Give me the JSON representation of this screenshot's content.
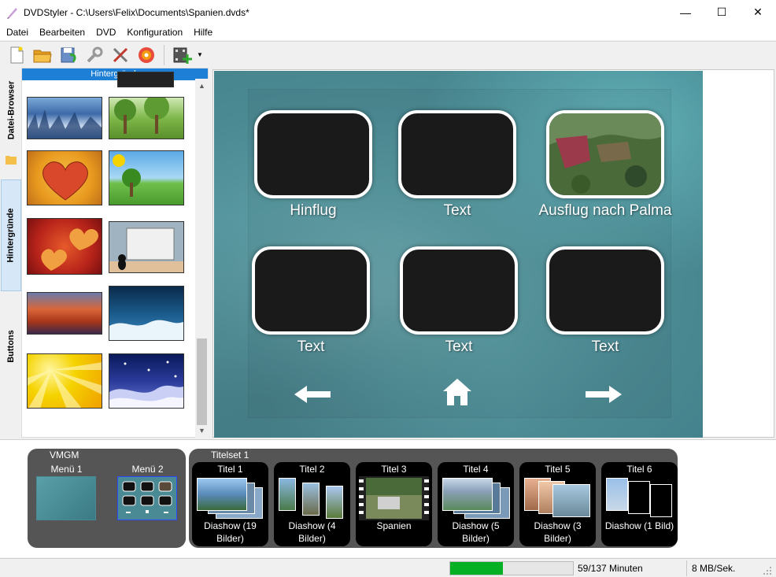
{
  "window": {
    "title": "DVDStyler - C:\\Users\\Felix\\Documents\\Spanien.dvds*",
    "minimize": "—",
    "maximize": "☐",
    "close": "✕"
  },
  "menubar": [
    "Datei",
    "Bearbeiten",
    "DVD",
    "Konfiguration",
    "Hilfe"
  ],
  "toolbar": {
    "icons": [
      "new-icon",
      "open-icon",
      "save-icon",
      "settings-icon",
      "tools-icon",
      "burn-icon",
      "add-file-icon"
    ]
  },
  "sidebar": {
    "tabs": [
      "Datei-Browser",
      "Hintergründe",
      "Buttons"
    ],
    "active_tab": "Hintergründe",
    "gallery_header": "Hintergründe"
  },
  "menu": {
    "buttons": [
      {
        "label": "Hinflug",
        "has_image": false
      },
      {
        "label": "Text",
        "has_image": false
      },
      {
        "label": "Ausflug nach Palma",
        "has_image": true
      },
      {
        "label": "Text",
        "has_image": false
      },
      {
        "label": "Text",
        "has_image": false
      },
      {
        "label": "Text",
        "has_image": false
      }
    ],
    "nav": [
      "arrow-left-icon",
      "home-icon",
      "arrow-right-icon"
    ]
  },
  "titleset": {
    "vmgm_label": "VMGM",
    "titleset_label": "Titelset 1",
    "menus": [
      {
        "title": "Menü 1"
      },
      {
        "title": "Menü 2"
      }
    ],
    "titles": [
      {
        "title": "Titel 1",
        "caption": "Diashow (19 Bilder)"
      },
      {
        "title": "Titel 2",
        "caption": "Diashow (4 Bilder)"
      },
      {
        "title": "Titel 3",
        "caption": "Spanien"
      },
      {
        "title": "Titel 4",
        "caption": "Diashow (5 Bilder)"
      },
      {
        "title": "Titel 5",
        "caption": "Diashow (3 Bilder)"
      },
      {
        "title": "Titel 6",
        "caption": "Diashow (1 Bild)"
      }
    ]
  },
  "status": {
    "progress_fraction": 0.43,
    "duration": "59/137 Minuten",
    "bitrate": "8 MB/Sek."
  }
}
